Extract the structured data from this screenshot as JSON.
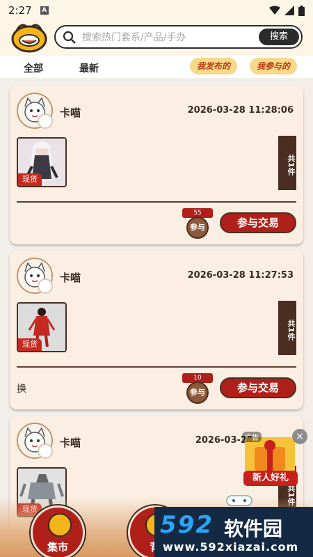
{
  "status": {
    "time": "2:27",
    "indicator": "A"
  },
  "header": {
    "search_placeholder": "搜索热门套系/产品/手办",
    "search_button": "搜索"
  },
  "tabs": {
    "all": "全部",
    "latest": "最新",
    "my_posted": "我发布的",
    "my_joined": "我参与的"
  },
  "posts": [
    {
      "username": "卡喵",
      "timestamp": "2026-03-28 11:28:06",
      "tag": "现货",
      "more": "共1件",
      "note": "",
      "join_count": "55",
      "join_label": "参与",
      "trade_button": "参与交易"
    },
    {
      "username": "卡喵",
      "timestamp": "2026-03-28 11:27:53",
      "tag": "现货",
      "more": "共1件",
      "note": "换",
      "join_count": "10",
      "join_label": "参与",
      "trade_button": "参与交易"
    },
    {
      "username": "卡喵",
      "timestamp": "2026-03-28",
      "tag": "现货",
      "more": "共1件",
      "note": "",
      "join_count": "",
      "join_label": "",
      "trade_button": ""
    }
  ],
  "ad": {
    "label": "广告",
    "close": "×",
    "text": "新人好礼"
  },
  "bottom_nav": {
    "market": "集市",
    "bag": "背"
  },
  "watermark": {
    "number": "592",
    "name": "软件园",
    "url": "www.592xiazai.com"
  },
  "colors": {
    "accent_red": "#b0201a",
    "brown": "#4a2e22",
    "card_bg": "#fbeee2",
    "header_bg": "#fdf6e6"
  }
}
